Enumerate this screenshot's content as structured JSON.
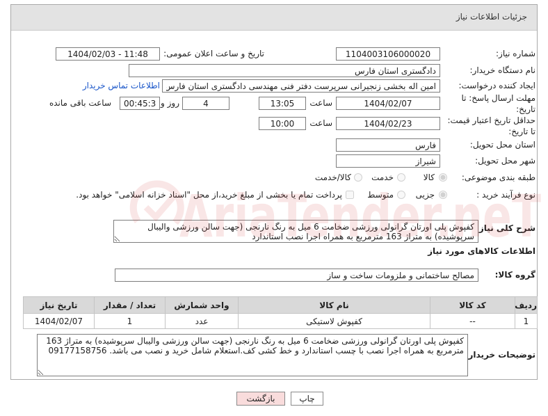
{
  "header": {
    "title": "جزئیات اطلاعات نیاز"
  },
  "fields": {
    "need_number": {
      "label": "شماره نیاز:",
      "value": "1104003106000020"
    },
    "announce": {
      "label": "تاریخ و ساعت اعلان عمومی:",
      "value": "1404/02/03 - 11:48"
    },
    "buyer_org": {
      "label": "نام دستگاه خریدار:",
      "value": "دادگستری استان فارس"
    },
    "requester": {
      "label": "ایجاد کننده درخواست:",
      "value": "امین اله بخشی زنجیرانی سرپرست دفتر فنی مهندسی دادگستری استان فارس",
      "contact_link": "اطلاعات تماس خریدار"
    },
    "deadline": {
      "label_1": "مهلت ارسال پاسخ: تا",
      "label_2": "تاریخ:",
      "date": "1404/02/07",
      "time_label": "ساعت",
      "time": "13:05",
      "days": "4",
      "days_label": "روز و",
      "remaining": "00:45:35",
      "remaining_label": "ساعت باقی مانده"
    },
    "price_validity": {
      "label_1": "حداقل تاریخ اعتبار قیمت:",
      "label_2": "تا تاریخ:",
      "date": "1404/02/23",
      "time_label": "ساعت",
      "time": "10:00"
    },
    "province": {
      "label": "استان محل تحویل:",
      "value": "فارس"
    },
    "city": {
      "label": "شهر محل تحویل:",
      "value": "شیراز"
    },
    "category": {
      "label": "طبقه بندی موضوعی:",
      "options": [
        "کالا",
        "خدمت",
        "کالا/خدمت"
      ],
      "selected": "کالا"
    },
    "process": {
      "label": "نوع فرآیند خرید :",
      "options": [
        "جزیی",
        "متوسط"
      ],
      "selected": "جزیی",
      "treasury_checked": false,
      "treasury_note": "پرداخت تمام یا بخشی از مبلغ خرید،از محل \"اسناد خزانه اسلامی\" خواهد بود."
    },
    "description": {
      "label": "شرح کلی نیاز:",
      "value": "کفپوش پلی اورتان گرانولی ورزشی ضخامت 6 میل به رنگ نارنجی (جهت سالن ورزشی والیبال سرپوشیده) به متراژ 163 مترمربع به همراه اجرا نصب استاندارد"
    }
  },
  "goods": {
    "heading": "اطلاعات کالاهای مورد نیاز",
    "group_label": "گروه کالا:",
    "group_value": "مصالح ساختمانی و ملزومات ساخت و ساز",
    "table": {
      "headers": [
        "ردیف",
        "کد کالا",
        "نام کالا",
        "واحد شمارش",
        "تعداد / مقدار",
        "تاریخ نیاز"
      ],
      "rows": [
        [
          "1",
          "--",
          "کفپوش لاستیکی",
          "عدد",
          "1",
          "1404/02/07"
        ]
      ]
    }
  },
  "buyer_notes": {
    "label": "توضیحات خریدار:",
    "value": "کفپوش پلی اورتان گرانولی ورزشی ضخامت 6 میل به رنگ نارنجی (جهت سالن ورزشی والیبال سرپوشیده) به متراژ 163 مترمربع به همراه اجرا نصب با چسب استاندارد و خط کشی کف.استعلام شامل خرید و نصب می باشد. 09177158756"
  },
  "buttons": {
    "print": "چاپ",
    "back": "بازگشت"
  },
  "watermark": "AriaTender.neT",
  "colors": {
    "header_bg": "#e3e3e3",
    "link": "#1a56c9",
    "back_button_bg": "#f9dcdc",
    "watermark": "#d94848"
  }
}
